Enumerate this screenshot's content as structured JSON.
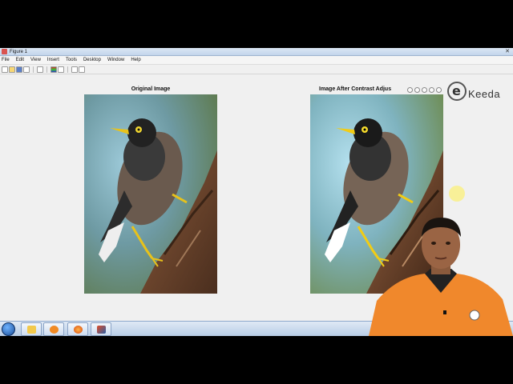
{
  "window": {
    "title": "Figure 1",
    "close": "✕"
  },
  "menu": [
    "File",
    "Edit",
    "View",
    "Insert",
    "Tools",
    "Desktop",
    "Window",
    "Help"
  ],
  "toolbar_icons": [
    "new-figure-icon",
    "open-file-icon",
    "save-icon",
    "print-icon",
    "link-icon",
    "insert-colorbar-icon",
    "insert-legend-icon",
    "pointer-icon",
    "plot-tools-icon"
  ],
  "axes_left": {
    "title": "Original Image"
  },
  "axes_right": {
    "title": "Image After Contrast Adjus"
  },
  "axes_tool_icons": [
    "brush-icon",
    "pan-icon",
    "zoom-in-icon",
    "zoom-out-icon",
    "home-icon"
  ],
  "logo": {
    "letter": "e",
    "word": "Keeda"
  },
  "taskbar_items": [
    "start-button",
    "file-explorer",
    "media-player",
    "firefox",
    "matlab"
  ],
  "colors": {
    "window_bg": "#f0f0f0",
    "taskbar": "#c8d9ee",
    "presenter_shirt": "#f0882c"
  }
}
